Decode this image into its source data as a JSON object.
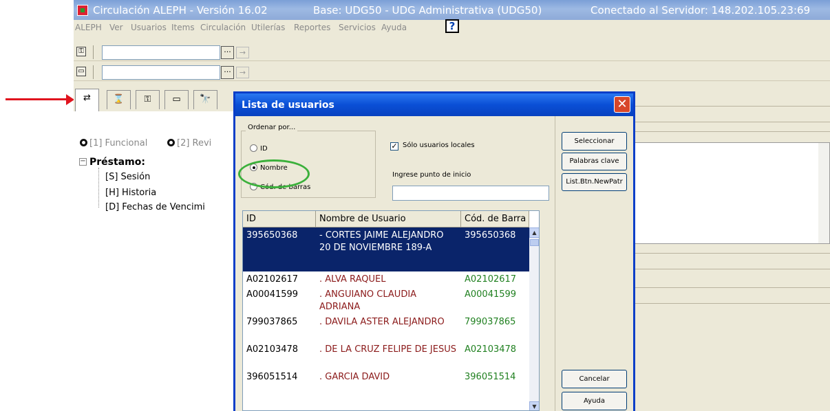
{
  "window": {
    "title": "Circulación ALEPH - Versión 16.02",
    "base": "Base:  UDG50 - UDG Administrativa (UDG50)",
    "server": "Conectado al Servidor:  148.202.105.23:69"
  },
  "menu": [
    "ALEPH",
    "Ver",
    "Usuarios",
    "Items",
    "Circulación",
    "Utilerías",
    "Reportes",
    "Servicios",
    "Ayuda"
  ],
  "help_button": "?",
  "toolbar": {
    "row1": {
      "icon": "patron-icon",
      "value": "",
      "browse": "···",
      "go": "→"
    },
    "row2": {
      "icon": "item-icon",
      "value": "",
      "browse": "···",
      "go": "→"
    }
  },
  "left_panel": {
    "tabs": [
      "⇄",
      "⌛",
      "⚿",
      "▭",
      "🔭"
    ],
    "mode1": "[1] Funcional",
    "mode2": "[2] Revi",
    "tree_toggle": "−",
    "tree_root": "Préstamo:",
    "tree_items": [
      "[S] Sesión",
      "[H] Historia",
      "[D] Fechas de Vencimi"
    ]
  },
  "dialog": {
    "title": "Lista de usuarios",
    "close": "✕",
    "sort_group_label": "Ordenar por...",
    "sort_options": [
      "ID",
      "Nombre",
      "Cód. de barras"
    ],
    "sort_selected": "Nombre",
    "local_only_label": "Sólo usuarios locales",
    "local_only_checked": true,
    "start_point_label": "Ingrese punto de inicio",
    "start_point_value": "",
    "buttons": {
      "select": "Seleccionar",
      "keywords": "Palabras clave",
      "new_patron": "List.Btn.NewPatr",
      "cancel": "Cancelar",
      "help": "Ayuda"
    },
    "table": {
      "headers": [
        "ID",
        "Nombre de Usuario",
        "Cód. de Barra"
      ],
      "rows": [
        {
          "id": "395650368",
          "name": "- CORTES JAIME ALEJANDRO",
          "addr": "20 DE NOVIEMBRE 189-A",
          "barcode": "395650368",
          "selected": true
        },
        {
          "id": "A02102617",
          "name": ". ALVA RAQUEL",
          "barcode": "A02102617"
        },
        {
          "id": "A00041599",
          "name": ". ANGUIANO CLAUDIA ADRIANA",
          "barcode": "A00041599"
        },
        {
          "id": "799037865",
          "name": ". DAVILA ASTER ALEJANDRO",
          "barcode": "799037865"
        },
        {
          "id": "A02103478",
          "name": ". DE LA CRUZ FELIPE DE JESUS",
          "barcode": "A02103478"
        },
        {
          "id": "396051514",
          "name": ". GARCIA DAVID",
          "barcode": "396051514"
        }
      ]
    }
  },
  "colors": {
    "title_bar": "#8eaad8",
    "dialog_title": "#0a4fd6",
    "selection": "#0a246a",
    "name_text": "#8b1a1a",
    "barcode_text": "#208020",
    "annotation_arrow": "#e0141e",
    "annotation_circle": "#3bb03b"
  }
}
